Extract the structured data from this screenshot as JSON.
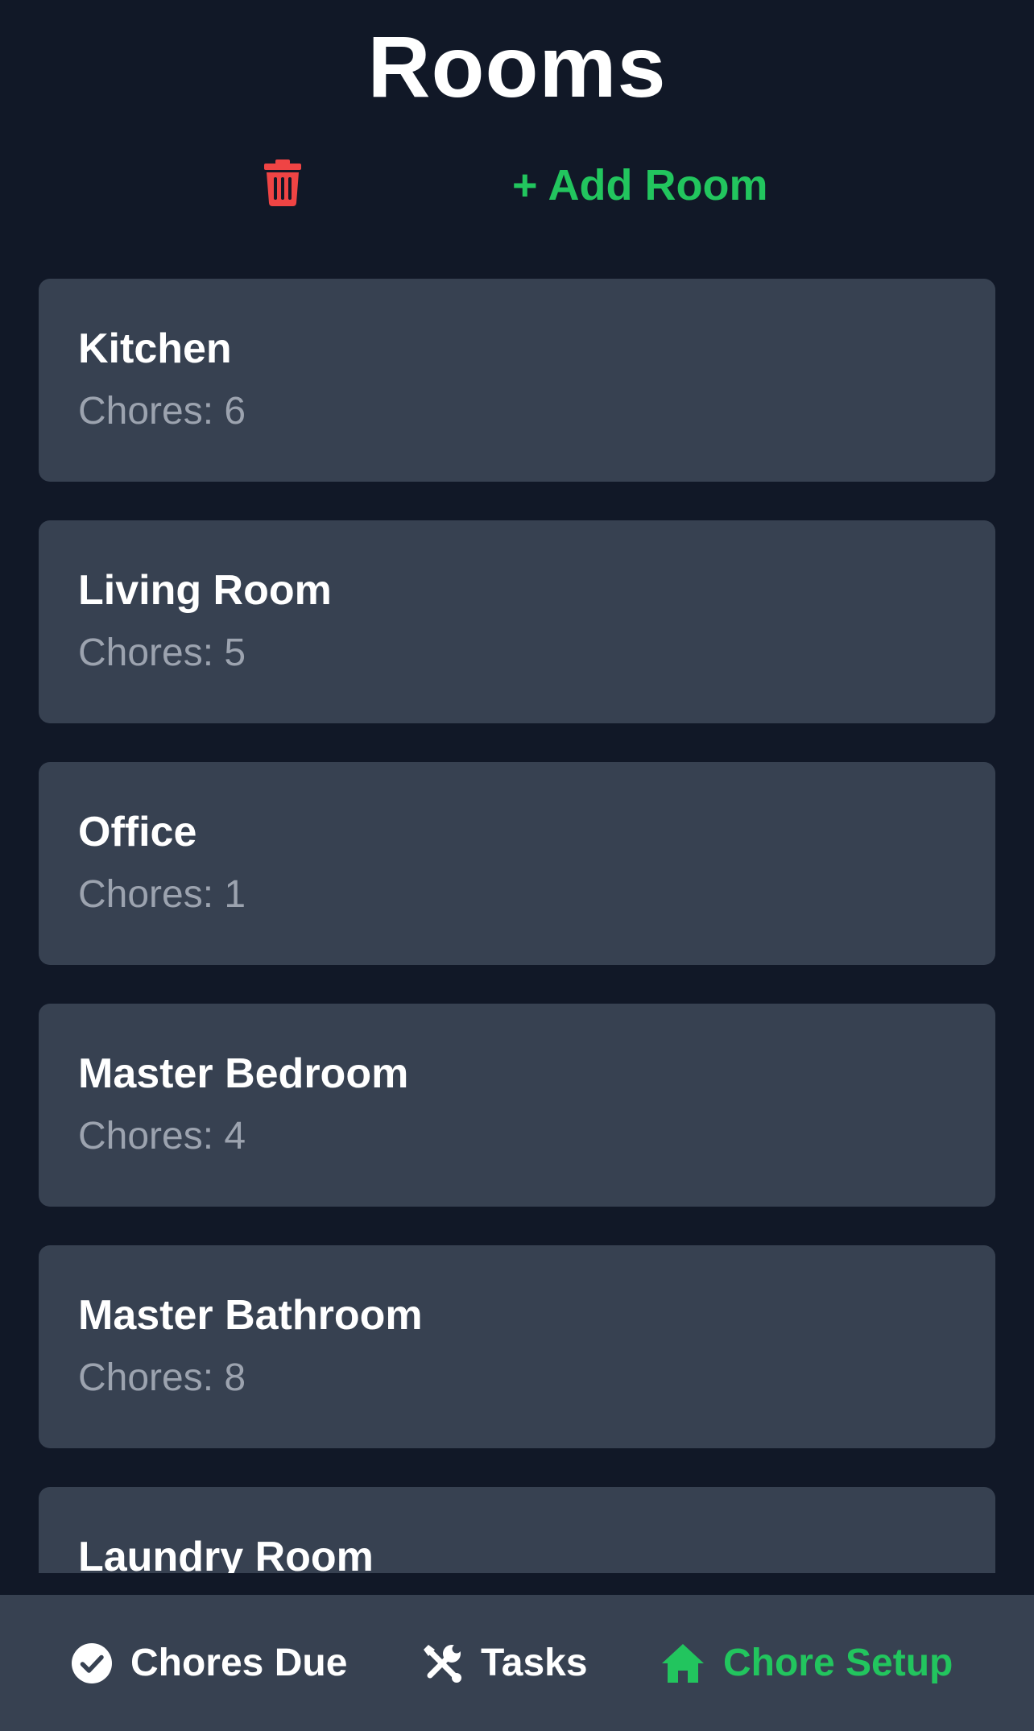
{
  "header": {
    "title": "Rooms",
    "delete_icon": "trash-icon",
    "add_room_label": "+ Add Room"
  },
  "rooms": [
    {
      "name": "Kitchen",
      "chores": "Chores: 6"
    },
    {
      "name": "Living Room",
      "chores": "Chores: 5"
    },
    {
      "name": "Office",
      "chores": "Chores: 1"
    },
    {
      "name": "Master Bedroom",
      "chores": "Chores: 4"
    },
    {
      "name": "Master Bathroom",
      "chores": "Chores: 8"
    },
    {
      "name": "Laundry Room",
      "chores": ""
    }
  ],
  "bottom_nav": {
    "items": [
      {
        "label": "Chores Due",
        "icon": "check-circle-icon",
        "active": false
      },
      {
        "label": "Tasks",
        "icon": "tools-icon",
        "active": false
      },
      {
        "label": "Chore Setup",
        "icon": "home-icon",
        "active": true
      }
    ]
  },
  "colors": {
    "background": "#111827",
    "card": "#374151",
    "accent": "#22c55e",
    "danger": "#ef4444",
    "muted_text": "#9ca3af"
  }
}
